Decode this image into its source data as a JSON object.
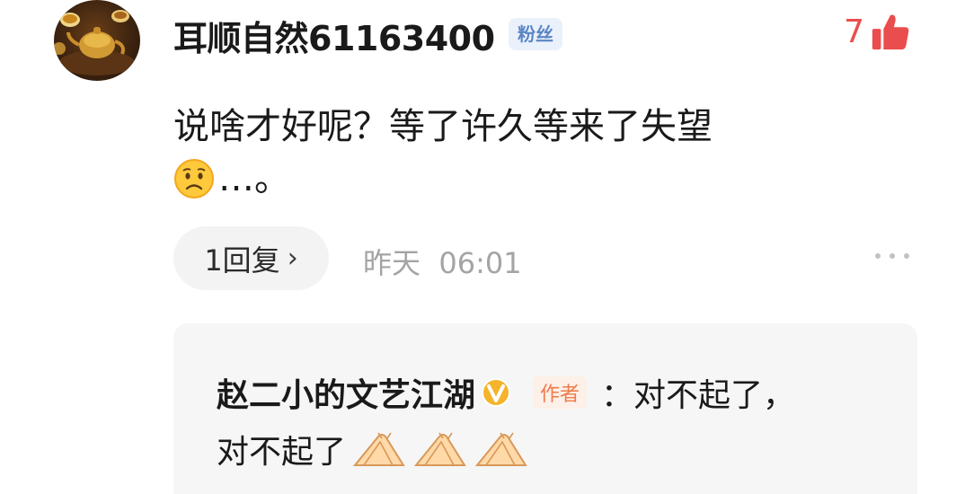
{
  "comment": {
    "username": "耳顺自然61163400",
    "fan_badge": "粉丝",
    "like_count": "7",
    "text": "说啥才好呢？等了许久等来了失望",
    "text_tail": "…。",
    "reply_count_label": "1回复",
    "reply_arrow": "›",
    "time": "昨天  06:01"
  },
  "reply": {
    "author": "赵二小的文艺江湖",
    "author_tag": "作者",
    "text_line1": "：对不起了，",
    "text_line2": "对不起了"
  },
  "icons": {
    "like": "thumbs-up-icon",
    "verified": "verified-v-icon",
    "more": "more-dots-icon",
    "emoji_sad": "sad-face-emoji",
    "emoji_hands": "clapping-hands-emoji"
  },
  "colors": {
    "like_red": "#ea4d4d",
    "time_gray": "#a4a4a4",
    "fan_badge_bg": "#eaf1fb",
    "fan_badge_text": "#5b86c4",
    "author_tag_text": "#ef7b4a",
    "verified_gold": "#f4b42b"
  }
}
